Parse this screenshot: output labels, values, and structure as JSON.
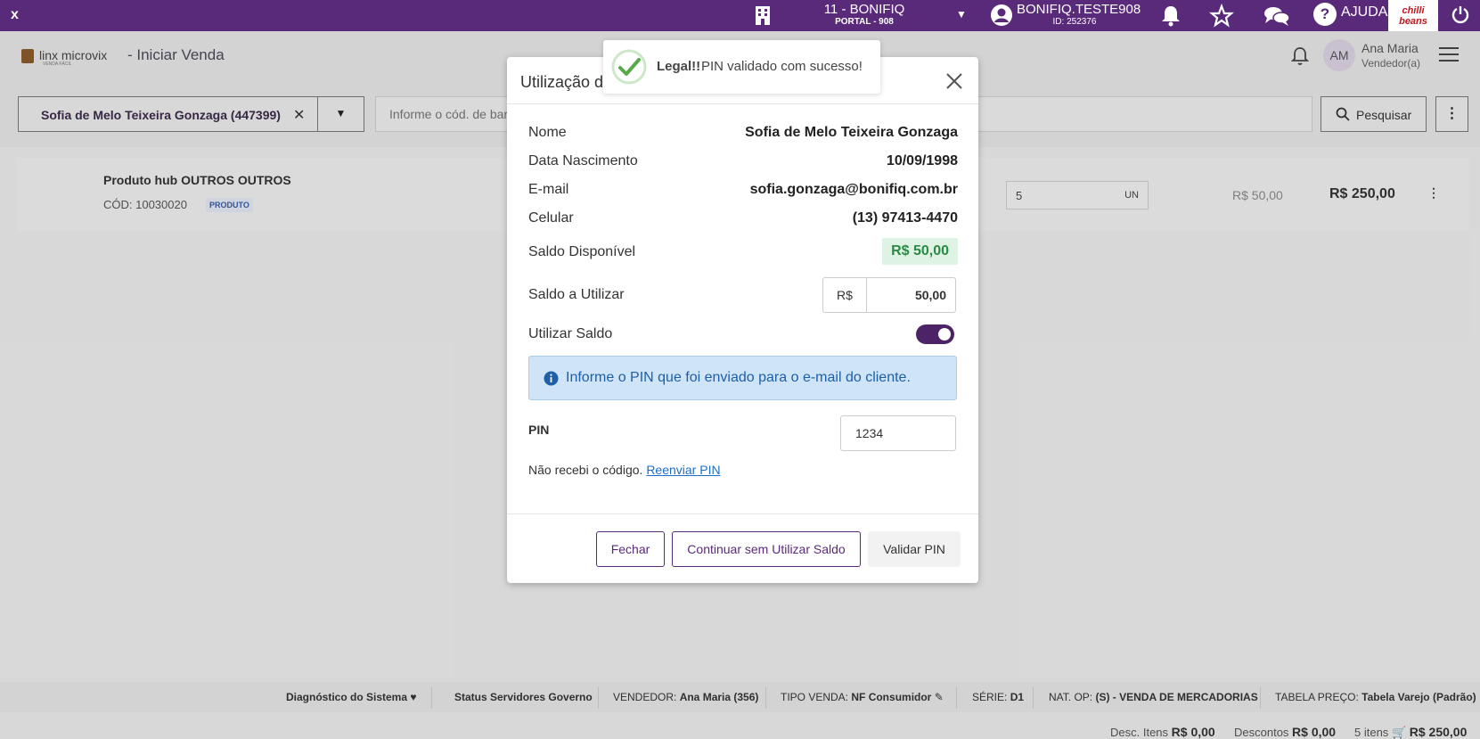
{
  "topbar": {
    "close_label": "x",
    "store_name": "11 - BONIFIQ",
    "store_portal": "PORTAL - 908",
    "user_name": "BONIFIQ.TESTE908",
    "user_id": "ID: 252376",
    "help_label": "AJUDA",
    "brand_label": "chilli beans",
    "color": "#5a2a7a"
  },
  "header": {
    "logo_text": "linx microvix",
    "logo_sub": "VENDA FÁCIL",
    "page_title": "-  Iniciar Venda",
    "avatar_initials": "AM",
    "user_name": "Ana Maria",
    "user_role": "Vendedor(a)"
  },
  "search": {
    "customer_name": "Sofia de Melo Teixeira Gonzaga (447399)",
    "placeholder": "Informe o cód. de barras",
    "search_button": "Pesquisar"
  },
  "product": {
    "name": "Produto hub OUTROS OUTROS",
    "code": "CÓD: 10030020",
    "tag": "PRODUTO",
    "quantity": "5",
    "unit": "UN",
    "unit_price": "R$ 50,00",
    "total": "R$ 250,00"
  },
  "modal": {
    "title": "Utilização de",
    "fields": [
      {
        "label": "Nome",
        "value": "Sofia de Melo Teixeira Gonzaga"
      },
      {
        "label": "Data Nascimento",
        "value": "10/09/1998"
      },
      {
        "label": "E-mail",
        "value": "sofia.gonzaga@bonifiq.com.br"
      },
      {
        "label": "Celular",
        "value": "(13) 97413-4470"
      }
    ],
    "saldo_label": "Saldo Disponível",
    "saldo_value": "R$ 50,00",
    "usar_label": "Saldo a Utilizar",
    "currency": "R$",
    "usar_value": "50,00",
    "toggle_label": "Utilizar Saldo",
    "toggle_on": true,
    "info_text": "Informe o PIN que foi enviado para o e-mail do cliente.",
    "pin_label": "PIN",
    "pin_value": "1234",
    "resend_text": "Não recebi o código.",
    "resend_link": "Reenviar PIN",
    "btn_close": "Fechar",
    "btn_continue": "Continuar sem Utilizar Saldo",
    "btn_validate": "Validar PIN"
  },
  "toast": {
    "title": "Legal!!",
    "message": "PIN validado com sucesso!"
  },
  "footer": {
    "diag": "Diagnóstico do Sistema",
    "status": "Status Servidores Governo",
    "vendedor_label": "VENDEDOR:",
    "vendedor_value": "Ana Maria (356)",
    "tipo_label": "TIPO VENDA:",
    "tipo_value": "NF Consumidor",
    "serie_label": "SÉRIE:",
    "serie_value": "D1",
    "natop_label": "NAT. OP:",
    "natop_value": "(S) - VENDA DE MERCADORIAS",
    "tabela_label": "TABELA PREÇO:",
    "tabela_value": "Tabela Varejo (Padrão)"
  },
  "totals": {
    "desc_itens_label": "Desc. Itens",
    "desc_itens_value": "R$ 0,00",
    "descontos_label": "Descontos",
    "descontos_value": "R$ 0,00",
    "itens_label": "5 itens",
    "total_value": "R$ 250,00"
  }
}
